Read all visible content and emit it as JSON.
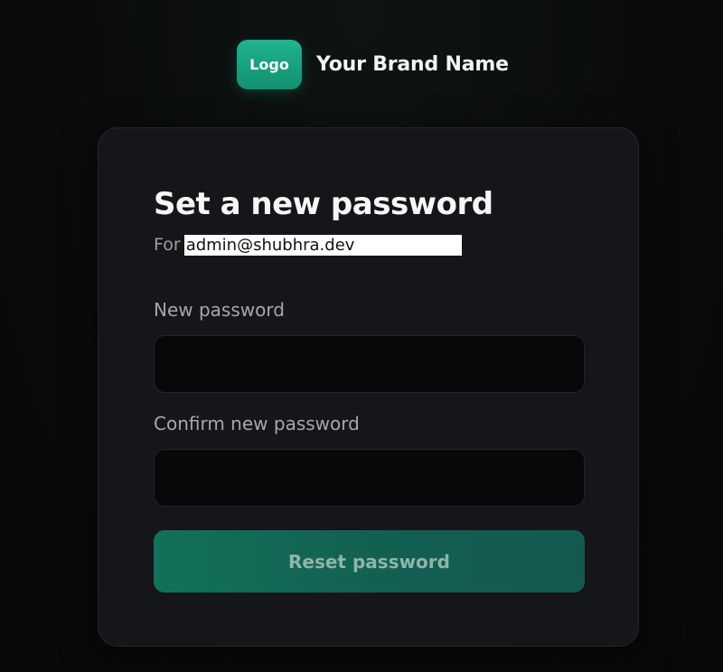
{
  "brand": {
    "logo_text": "Logo",
    "name": "Your Brand Name"
  },
  "form": {
    "title": "Set a new password",
    "subtitle_prefix": "For",
    "email": "admin@shubhra.dev",
    "new_password_label": "New password",
    "new_password_value": "",
    "confirm_password_label": "Confirm new password",
    "confirm_password_value": "",
    "submit_label": "Reset password"
  },
  "colors": {
    "accent": "#1fb48f",
    "button": "#12715a",
    "background": "#0a0c0c",
    "card": "#15161a"
  }
}
